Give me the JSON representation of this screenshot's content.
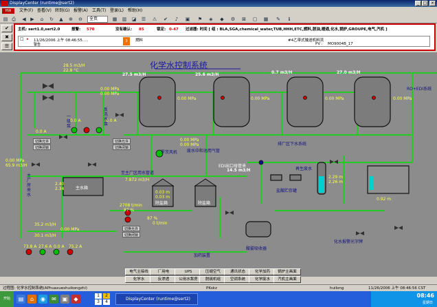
{
  "window": {
    "title": "DisplayCenter (runtime@sert2)",
    "minimize": "_",
    "maximize": "□",
    "close": "×"
  },
  "menu": {
    "items": [
      "文件(F)",
      "查看(V)",
      "转到(G)",
      "报警(A)",
      "工具(T)",
      "登录(L)",
      "帮助(H)"
    ]
  },
  "toolbar": {
    "select_value": "全页"
  },
  "alarm": {
    "host_label": "主机: sert1.0,sert2.0",
    "alarms_label": "报警:",
    "alarms_count": "570",
    "unack_label": "没有确认:",
    "unack_count": "85",
    "locked_label": "锁定:",
    "locked_count": "0-47",
    "filter": "过滤器: 时间 [ 组 : BLA,SGA,chemical_water,TUB,HHH,ETC,燃料,脱油,暖通,化水,锅炉,GROUPE,电气,汽机 ]",
    "row": {
      "datetime": "11/26/2006 上午 08:46:55.....",
      "status": "警告",
      "category": "燃料",
      "description": "#4乙带式输送机料流",
      "pv_label": "PV :",
      "pv_value": "MO9004B_17"
    }
  },
  "process": {
    "title": "化学水控制系统",
    "tank_flows": [
      "27.5 m3/H",
      "25.6 m3/H",
      "0.7 m3/H",
      "27.0 m3/H"
    ],
    "tank_pressures": [
      "0.00 MPa",
      "0.00 MPa",
      "0.00 MPa",
      "0.00 MPa"
    ],
    "top_flow": "28.5 m3/H",
    "top_temp": "22.8 °C",
    "left_a1": "0.0 A",
    "left_a2": "0.0 A",
    "left_a3": "0.0 A",
    "mid_p1": "0.00 MPa",
    "mid_p2": "0.00 MPa",
    "left_p": "0.00 MPa",
    "left_flow": "65.9 m3/H",
    "tank_level1": "2.40",
    "tank_level2": "2.34",
    "left_bottom_flow": "35.2 m3/H",
    "left_bottom_p": "0.00 MPa",
    "left_bottom_flow2": "30.1 m3/H",
    "pump_a": [
      "73.8 A",
      "27.6 A",
      "0.0 A",
      "75.2 A"
    ],
    "water_flow": "7.872 m3/H",
    "water_flow2": "0.00 MPa",
    "level_m1": "2.29 m",
    "level_m2": "2.26 m",
    "level_m3": "0.03 m",
    "level_m4": "0.03 m",
    "right_flow": "0.92 m",
    "edi_label": "EDI出口母管来",
    "edi_flow": "14.5 m3/H",
    "acid_label": "再生废水",
    "tank_labels": [
      "主水箱",
      "除盐箱",
      "除盐箱"
    ],
    "labels": {
      "ro_edi": "RO+EDI系统",
      "blower": "罗茨风机",
      "zhongtai": "至主厂区用水管道",
      "waste": "废水中和池用气管",
      "drain": "排厂区下水系统",
      "acid_storage": "盐酸贮存罐",
      "dosing": "加药装置",
      "neutral": "酸雾吸收器",
      "alarm_text": "化水报警光字牌",
      "source": "主厂房来水",
      "pump1": "一级泵",
      "pump_ab": "反洗水泵",
      "feed": "来水",
      "feed_rate": "2708 t/min",
      "feed_pct": "87 %",
      "pct2": "87 %",
      "pct3": "0 t/min"
    },
    "switch_labels": [
      "切换允许",
      "切换闭锁",
      "切换允许",
      "切换闭锁",
      "切换允许",
      "切换闭锁"
    ]
  },
  "nav": {
    "row1": [
      "电气主接线",
      "厂用电",
      "UPS",
      "压缩空气",
      "通讯状态",
      "化学加药",
      "锅炉主画面"
    ],
    "row2": [
      "化学水",
      "反渗透",
      "公用水泵房",
      "脱硫机组",
      "空调系统",
      "化学废水",
      "汽机主画面"
    ]
  },
  "status": {
    "page": "过程图: 化学水控制系统(APhuaxueshuikongzhi)",
    "mode": "PKskz",
    "user": "huilong",
    "datetime": "11/26/2006 上午 08:46:56 CST"
  },
  "taskbar": {
    "start": "开始",
    "workspaces": [
      "1",
      "2",
      "3",
      "4"
    ],
    "task": "DisplayCenter (runtime@sert2)",
    "clock": "08:46",
    "day": "星期日"
  }
}
